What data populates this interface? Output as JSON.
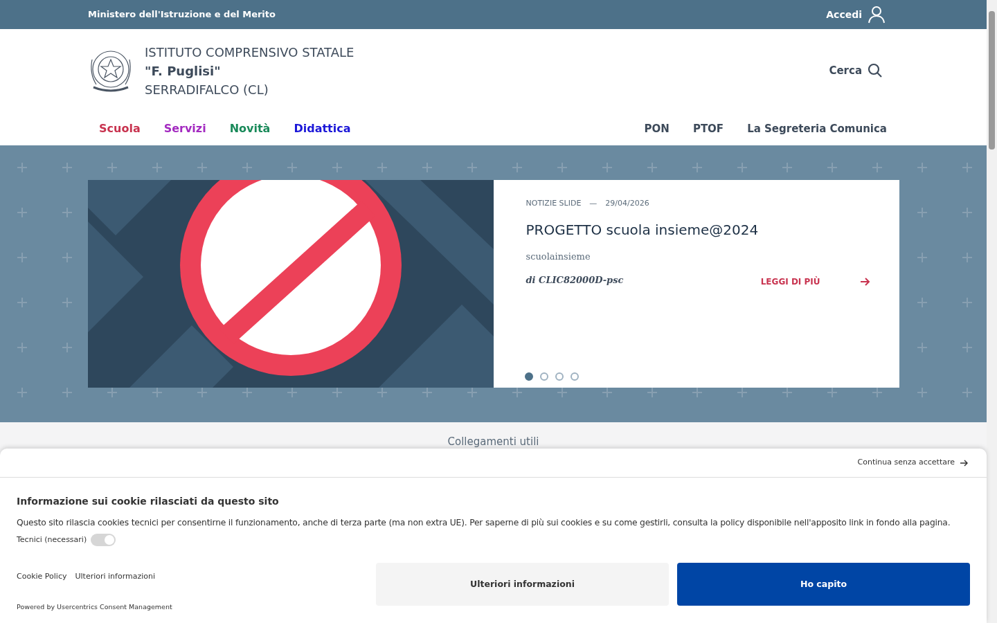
{
  "top_bar": {
    "ministry": "Ministero dell'Istruzione e del Merito",
    "login": "Accedi"
  },
  "header": {
    "title_line1": "ISTITUTO COMPRENSIVO STATALE",
    "title_line2": "\"F. Puglisi\"",
    "title_line3": "SERRADIFALCO (CL)",
    "search": "Cerca"
  },
  "main_nav": [
    {
      "label": "Scuola",
      "color": "#c8334f"
    },
    {
      "label": "Servizi",
      "color": "#a32ac0"
    },
    {
      "label": "Novità",
      "color": "#1a8a5a"
    },
    {
      "label": "Didattica",
      "color": "#1c18d8"
    }
  ],
  "secondary_nav": [
    "PON",
    "PTOF",
    "La Segreteria Comunica"
  ],
  "slide": {
    "category": "NOTIZIE SLIDE",
    "separator": "—",
    "date": "29/04/2026",
    "title": "PROGETTO scuola insieme@2024",
    "summary": "scuolainsieme",
    "author": "di CLIC82000D-psc",
    "read_more": "LEGGI DI PIÙ"
  },
  "slide_dots": [
    {
      "selected": true
    },
    {
      "selected": false
    },
    {
      "selected": false
    },
    {
      "selected": false
    }
  ],
  "section_title": "Collegamenti utili",
  "cookie_banner": {
    "continue": "Continua senza accettare",
    "heading": "Informazione sui cookie rilasciati da questo sito",
    "text": "Questo sito rilascia cookies tecnici per consentirne il funzionamento, anche di terza parte (ma non extra UE). Per saperne di più sui cookies e su come gestirli, consulta la policy disponibile nell'apposito link in fondo alla pagina.",
    "toggle": {
      "label": "Tecnici (necessari)",
      "checked": true,
      "disabled": true
    },
    "links": [
      "Cookie Policy",
      "Ulteriori informazioni"
    ],
    "powered": "Powered by Usercentrics Consent Management",
    "buttons": [
      {
        "label": "Ulteriori informazioni",
        "kind": "secondary"
      },
      {
        "label": "Ho capito",
        "kind": "primary"
      }
    ]
  }
}
